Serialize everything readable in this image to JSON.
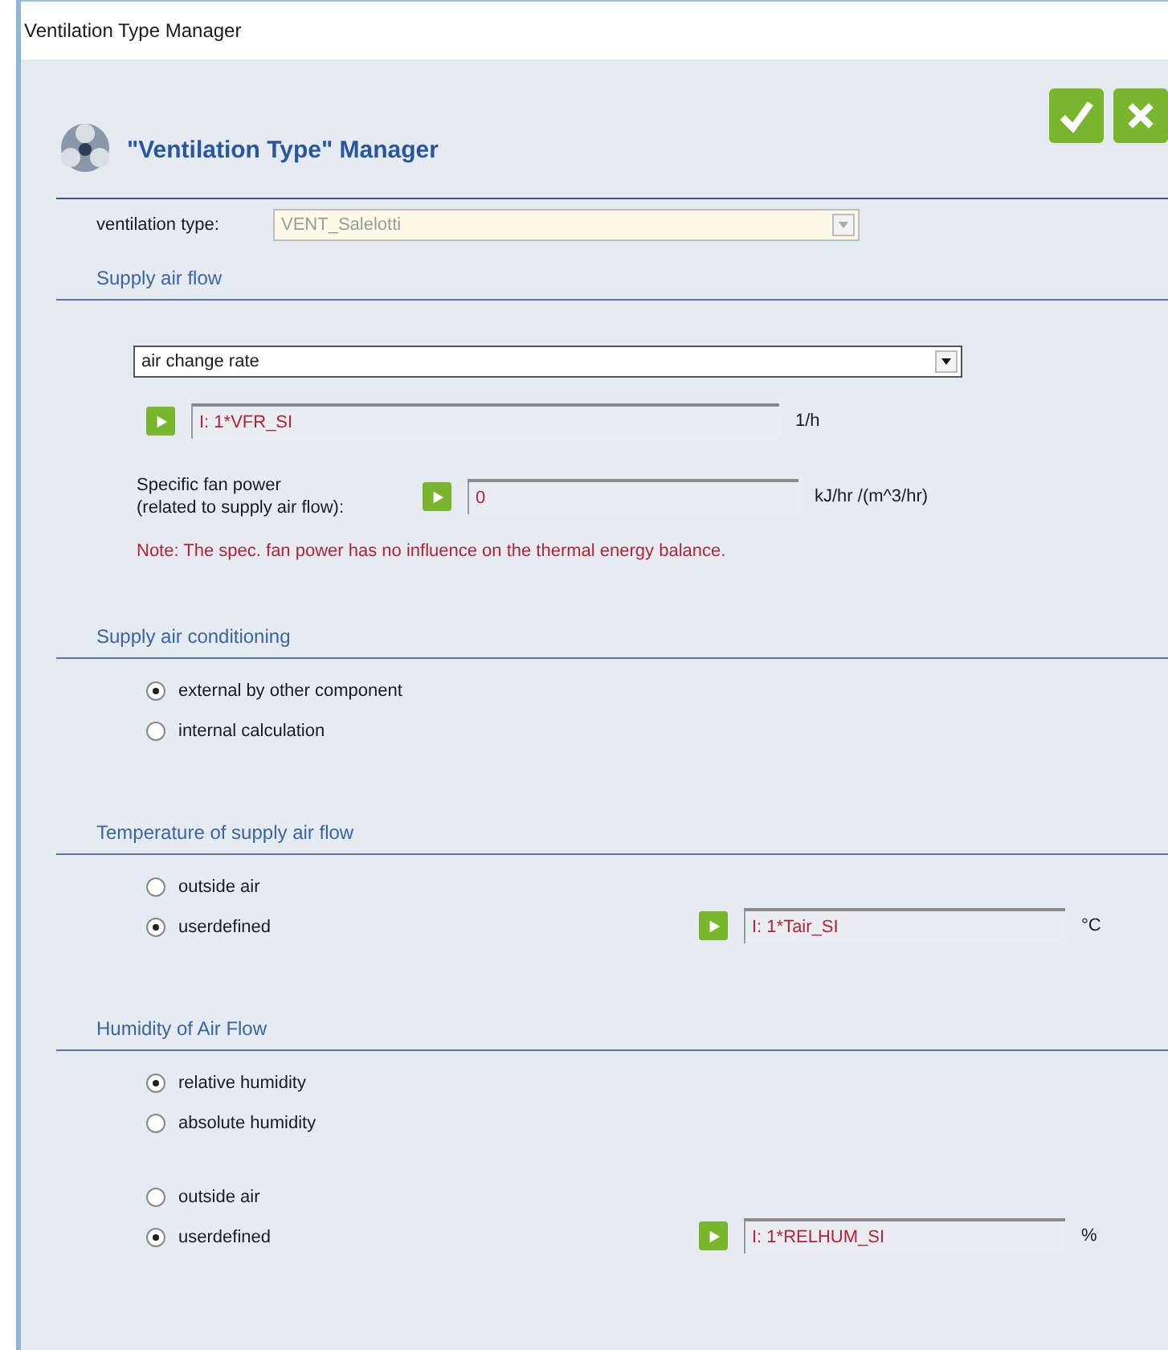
{
  "window": {
    "title": "Ventilation Type Manager"
  },
  "header": {
    "title": "\"Ventilation Type\" Manager"
  },
  "ventilation_type": {
    "label": "ventilation type:",
    "value": "VENT_Salelotti"
  },
  "sections": [
    {
      "title": "Supply air flow",
      "items": [
        {
          "kind": "select",
          "value": "air change rate"
        },
        {
          "kind": "formula",
          "value": "I: 1*VFR_SI",
          "unit": "1/h"
        },
        {
          "kind": "formula",
          "label": "Specific fan power\n(related to supply air flow):",
          "value": "0",
          "unit": "kJ/hr /(m^3/hr)"
        },
        {
          "kind": "note",
          "text": "Note: The spec. fan power has no influence on the thermal energy balance."
        }
      ]
    },
    {
      "title": "Supply air conditioning",
      "items": [
        {
          "kind": "radio",
          "options": [
            {
              "label": "external by other component",
              "selected": true
            },
            {
              "label": "internal calculation",
              "selected": false
            }
          ]
        }
      ]
    },
    {
      "title": "Temperature of supply air flow",
      "items": [
        {
          "kind": "radio",
          "options": [
            {
              "label": "outside air",
              "selected": false
            },
            {
              "label": "userdefined",
              "selected": true
            }
          ],
          "formula": {
            "value": "I: 1*Tair_SI",
            "unit": "°C"
          }
        }
      ]
    },
    {
      "title": "Humidity of Air Flow",
      "items": [
        {
          "kind": "radio",
          "options": [
            {
              "label": "relative humidity",
              "selected": true
            },
            {
              "label": "absolute humidity",
              "selected": false
            }
          ]
        },
        {
          "kind": "radio",
          "options": [
            {
              "label": "outside air",
              "selected": false
            },
            {
              "label": "userdefined",
              "selected": true
            }
          ],
          "formula": {
            "value": "I: 1*RELHUM_SI",
            "unit": "%"
          }
        }
      ]
    }
  ]
}
